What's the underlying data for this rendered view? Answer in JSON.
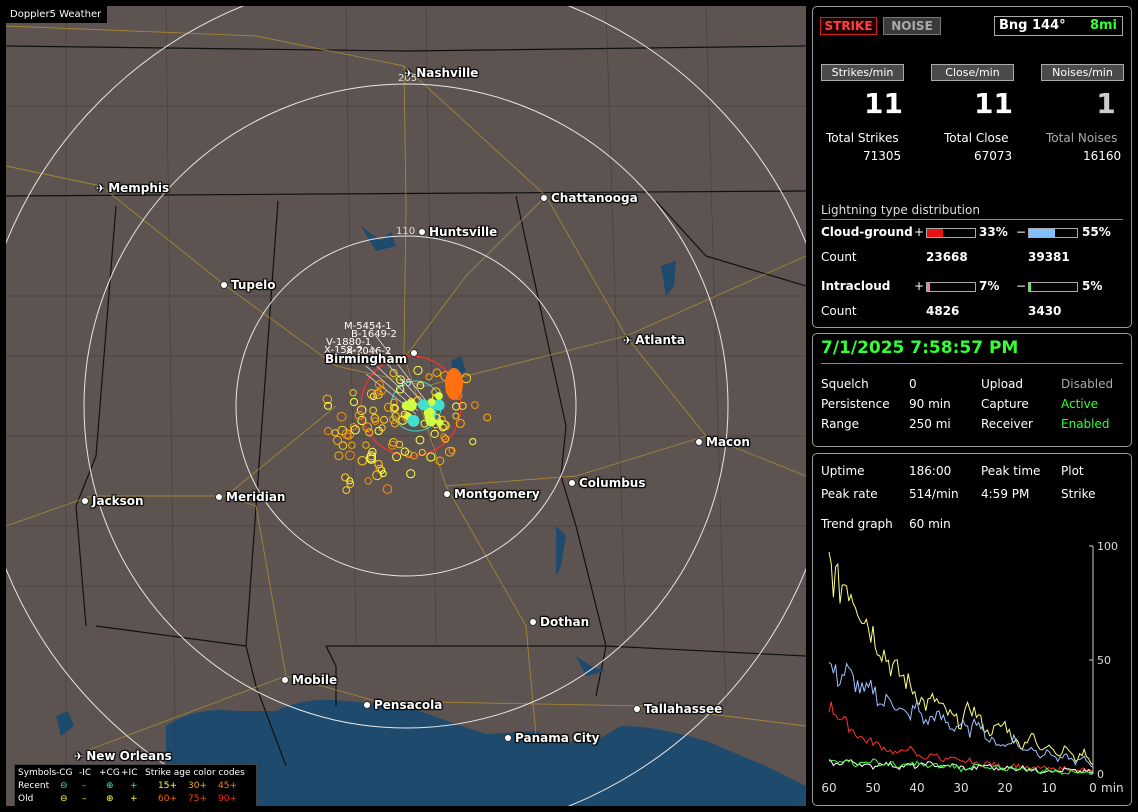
{
  "app": {
    "title": "Doppler5 Weather"
  },
  "map": {
    "cities": [
      {
        "name": "Nashville",
        "marker": "plane"
      },
      {
        "name": "Memphis",
        "marker": "plane"
      },
      {
        "name": "Chattanooga",
        "marker": "dot"
      },
      {
        "name": "Huntsville",
        "marker": "dot"
      },
      {
        "name": "Tupelo",
        "marker": "dot"
      },
      {
        "name": "Atlanta",
        "marker": "plane"
      },
      {
        "name": "Birmingham",
        "marker": "dot"
      },
      {
        "name": "Macon",
        "marker": "dot"
      },
      {
        "name": "Jackson",
        "marker": "dot"
      },
      {
        "name": "Meridian",
        "marker": "dot"
      },
      {
        "name": "Montgomery",
        "marker": "dot"
      },
      {
        "name": "Columbus",
        "marker": "dot"
      },
      {
        "name": "Dothan",
        "marker": "dot"
      },
      {
        "name": "Mobile",
        "marker": "dot"
      },
      {
        "name": "Pensacola",
        "marker": "dot"
      },
      {
        "name": "Tallahassee",
        "marker": "dot"
      },
      {
        "name": "Panama City",
        "marker": "dot"
      },
      {
        "name": "New Orleans",
        "marker": "plane"
      }
    ],
    "ring_labels": {
      "outer": "205",
      "inner": "110",
      "close": "15"
    },
    "storm_labels": [
      "M-5454-1",
      "B-1649-2",
      "V-1880-1",
      "X-158-2",
      "X-2046-2"
    ]
  },
  "legend": {
    "symbols_label": "Symbols",
    "cols": [
      "-CG",
      "-IC",
      "+CG",
      "+IC"
    ],
    "age_title": "Strike age color codes",
    "recent": {
      "label": "Recent",
      "glyphs": [
        "⊖",
        "–",
        "⊕",
        "+"
      ],
      "ages": [
        "15+",
        "30+",
        "45+"
      ]
    },
    "old": {
      "label": "Old",
      "glyphs": [
        "⊖",
        "–",
        "⊕",
        "+"
      ],
      "ages": [
        "60+",
        "75+",
        "90+"
      ]
    },
    "colors": {
      "recent": "#40e0d0",
      "age15": "#ffff40",
      "age30": "#ffb000",
      "age45": "#ff8000",
      "age60": "#ff6000",
      "age75": "#ff4000",
      "age90": "#ff2020"
    }
  },
  "panel": {
    "strike_button": "STRIKE",
    "noise_button": "NOISE",
    "bearing": "Bng 144°",
    "distance": "8mi",
    "rates": [
      {
        "label": "Strikes/min",
        "value": "11",
        "total_label": "Total Strikes",
        "total": "71305"
      },
      {
        "label": "Close/min",
        "value": "11",
        "total_label": "Total Close",
        "total": "67073"
      },
      {
        "label": "Noises/min",
        "value": "1",
        "total_label": "Total Noises",
        "total": "16160"
      }
    ],
    "distribution": {
      "title": "Lightning type distribution",
      "cloud_ground": {
        "label": "Cloud-ground",
        "pos_pct": "33%",
        "neg_pct": "55%",
        "pos": 0.33,
        "neg": 0.55
      },
      "cg_count": {
        "label": "Count",
        "pos": "23668",
        "neg": "39381"
      },
      "intracloud": {
        "label": "Intracloud",
        "pos_pct": "7%",
        "neg_pct": "5%",
        "pos": 0.07,
        "neg": 0.05
      },
      "ic_count": {
        "label": "Count",
        "pos": "4826",
        "neg": "3430"
      },
      "plus": "+",
      "minus": "−"
    }
  },
  "status": {
    "datetime": "7/1/2025 7:58:57 PM",
    "squelch_label": "Squelch",
    "squelch": "0",
    "persistence_label": "Persistence",
    "persistence": "90 min",
    "range_label": "Range",
    "range": "250 mi",
    "upload_label": "Upload",
    "upload": "Disabled",
    "capture_label": "Capture",
    "capture": "Active",
    "receiver_label": "Receiver",
    "receiver": "Enabled"
  },
  "trend": {
    "uptime_label": "Uptime",
    "uptime": "186:00",
    "peak_time_label": "Peak time",
    "peak_time": "4:59 PM",
    "plot_label": "Plot",
    "peak_rate_label": "Peak rate",
    "peak_rate": "514/min",
    "plot": "Strike",
    "trend_label": "Trend graph",
    "trend_window": "60 min",
    "y_ticks": [
      "100",
      "50",
      "0"
    ],
    "x_ticks": [
      "60",
      "50",
      "40",
      "30",
      "20",
      "10",
      "0"
    ],
    "x_unit": "min"
  },
  "chart_data": {
    "type": "line",
    "xlabel": "min",
    "xlim": [
      60,
      0
    ],
    "ylim": [
      0,
      100
    ],
    "x": [
      60,
      58,
      56,
      54,
      52,
      50,
      48,
      46,
      44,
      42,
      40,
      38,
      36,
      34,
      32,
      30,
      28,
      26,
      24,
      22,
      20,
      18,
      16,
      14,
      12,
      10,
      8,
      6,
      4,
      2,
      0
    ],
    "series": [
      {
        "color": "#ffff80",
        "values": [
          93,
          82,
          85,
          78,
          70,
          62,
          55,
          48,
          44,
          40,
          35,
          30,
          33,
          28,
          25,
          22,
          30,
          25,
          18,
          20,
          22,
          15,
          12,
          18,
          10,
          14,
          8,
          12,
          6,
          10,
          4
        ]
      },
      {
        "color": "#a0c0ff",
        "values": [
          48,
          42,
          45,
          40,
          35,
          38,
          30,
          34,
          28,
          25,
          30,
          22,
          26,
          24,
          20,
          22,
          18,
          25,
          15,
          14,
          12,
          16,
          10,
          12,
          8,
          10,
          6,
          8,
          5,
          7,
          3
        ]
      },
      {
        "color": "#ff3030",
        "values": [
          30,
          26,
          22,
          18,
          15,
          14,
          12,
          10,
          9,
          12,
          8,
          7,
          9,
          6,
          7,
          5,
          6,
          4,
          5,
          4,
          3,
          4,
          3,
          2,
          3,
          2,
          2,
          3,
          1,
          2,
          1
        ]
      },
      {
        "color": "#ffffff",
        "values": [
          5,
          4,
          6,
          5,
          4,
          3,
          5,
          4,
          3,
          4,
          3,
          5,
          4,
          3,
          4,
          3,
          2,
          3,
          4,
          2,
          3,
          2,
          3,
          2,
          1,
          2,
          1,
          2,
          1,
          1,
          1
        ]
      },
      {
        "color": "#40ff40",
        "values": [
          6,
          5,
          7,
          4,
          5,
          6,
          4,
          5,
          3,
          4,
          5,
          3,
          4,
          3,
          4,
          2,
          3,
          4,
          2,
          3,
          2,
          3,
          2,
          2,
          1,
          2,
          1,
          1,
          1,
          1,
          0
        ]
      }
    ]
  }
}
